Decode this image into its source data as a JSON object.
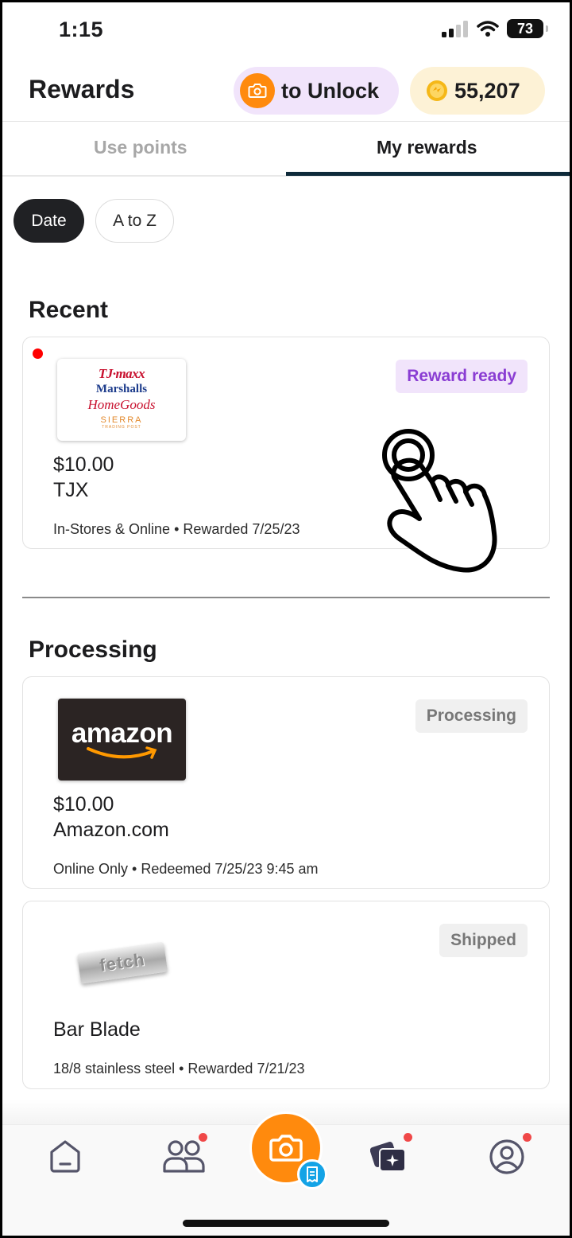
{
  "status_bar": {
    "time": "1:15",
    "battery": "73"
  },
  "header": {
    "title": "Rewards",
    "unlock_label": "to Unlock",
    "points": "55,207"
  },
  "tabs": [
    {
      "label": "Use points",
      "active": false
    },
    {
      "label": "My rewards",
      "active": true
    }
  ],
  "filters": [
    {
      "label": "Date",
      "selected": true
    },
    {
      "label": "A to Z",
      "selected": false
    }
  ],
  "sections": {
    "recent": {
      "title": "Recent",
      "card": {
        "status": "Reward ready",
        "amount": "$10.00",
        "name": "TJX",
        "meta": "In-Stores & Online • Rewarded 7/25/23",
        "logo_lines": [
          "TJ·maxx",
          "Marshalls",
          "HomeGoods",
          "SIERRA",
          "TRADING POST"
        ]
      }
    },
    "processing": {
      "title": "Processing",
      "cards": [
        {
          "status": "Processing",
          "amount": "$10.00",
          "name": "Amazon.com",
          "meta": "Online Only • Redeemed 7/25/23 9:45 am",
          "logo_text": "amazon"
        },
        {
          "status": "Shipped",
          "name": "Bar Blade",
          "meta": "18/8 stainless steel • Rewarded 7/21/23",
          "logo_text": "fetch"
        }
      ]
    }
  },
  "bottom_nav": [
    {
      "icon": "home-icon"
    },
    {
      "icon": "friends-icon",
      "notification": true
    },
    {
      "icon": "camera-icon",
      "badge_icon": "receipt-icon"
    },
    {
      "icon": "rewards-cards-icon",
      "notification": true
    },
    {
      "icon": "profile-icon",
      "notification": true
    }
  ],
  "colors": {
    "accent_orange": "#ff8a0d",
    "ready_purple": "#8a3dd3",
    "tab_underline": "#0e2a3a",
    "notification_red": "#f04848"
  }
}
